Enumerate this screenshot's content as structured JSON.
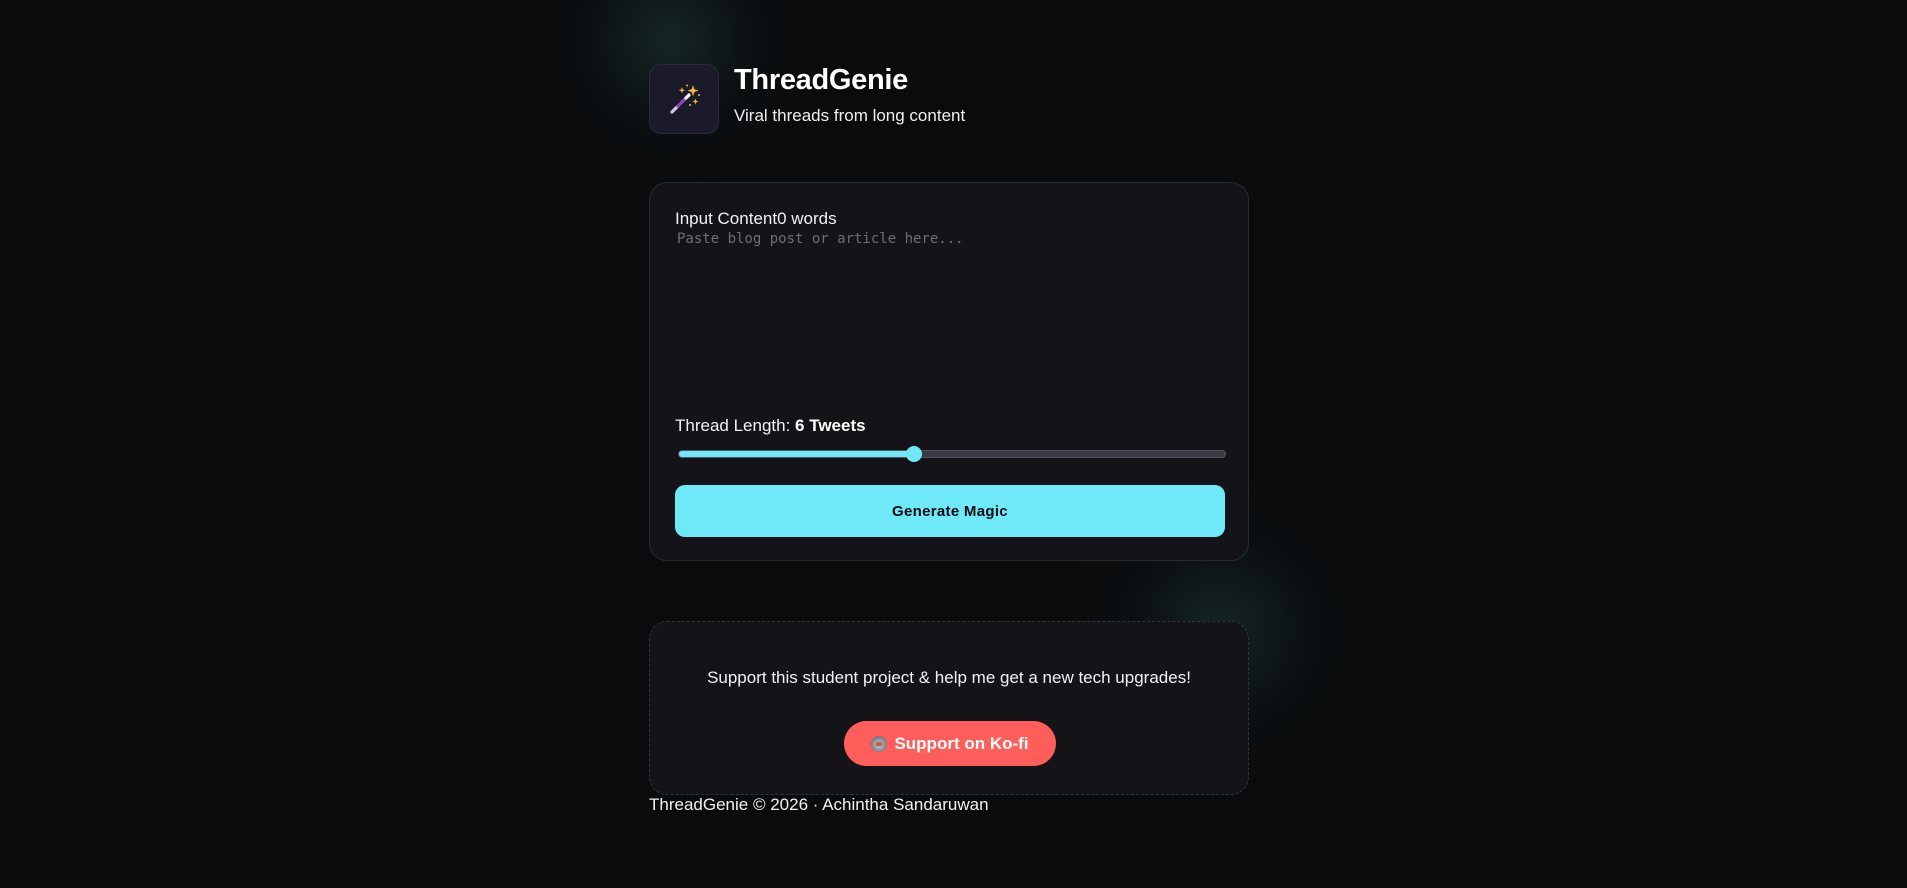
{
  "header": {
    "title": "ThreadGenie",
    "subtitle": "Viral threads from long content",
    "logo_icon": "magic-wand-icon"
  },
  "input": {
    "label": "Input Content",
    "word_count": "0 words",
    "placeholder": "Paste blog post or article here...",
    "value": ""
  },
  "thread_length": {
    "label": "Thread Length: ",
    "value_text": "6 Tweets",
    "level_fraction": 0.43
  },
  "generate_button": {
    "label": "Generate Magic"
  },
  "support": {
    "text": "Support this student project & help me get a new tech upgrades!",
    "button_label": "Support on Ko-fi",
    "button_icon": "coffee-cup-icon"
  },
  "footer": {
    "text": "ThreadGenie © 2026 · Achintha Sandaruwan"
  },
  "colors": {
    "background": "#0a0b0d",
    "card": "#131318",
    "accent": "#6fe8f8",
    "kofi": "#ff5e5b"
  }
}
